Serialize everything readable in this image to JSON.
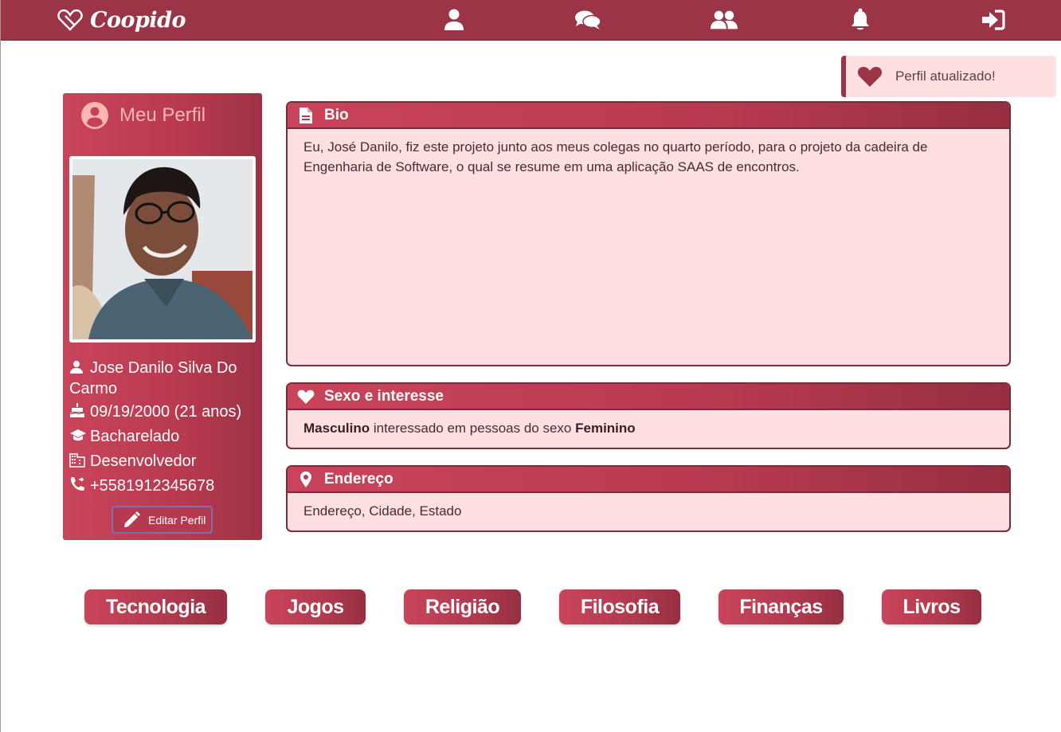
{
  "app": {
    "brand": "Coopido",
    "colors": {
      "primary": "#9b3446",
      "panel": "#fde0df",
      "accent": "#ffb6b1"
    }
  },
  "nav": {
    "items": [
      {
        "icon": "user-icon",
        "label": "Perfil"
      },
      {
        "icon": "chat-icon",
        "label": "Mensagens"
      },
      {
        "icon": "users-icon",
        "label": "Amigos"
      },
      {
        "icon": "bell-icon",
        "label": "Notificações"
      },
      {
        "icon": "sign-in-icon",
        "label": "Entrar"
      }
    ]
  },
  "toast": {
    "icon": "heart-icon",
    "message": "Perfil atualizado!"
  },
  "profile": {
    "title": "Meu Perfil",
    "name": "Jose Danilo Silva Do Carmo",
    "birthday": "09/19/2000 (21 anos)",
    "education": "Bacharelado",
    "job": "Desenvolvedor",
    "phone": "+5581912345678",
    "edit_label": "Editar Perfil"
  },
  "bio": {
    "title": "Bio",
    "text": "Eu, José Danilo, fiz este projeto junto aos meus colegas no quarto período, para o projeto da cadeira de Engenharia de Software, o qual se resume em uma aplicação SAAS de encontros."
  },
  "sexo": {
    "title": "Sexo e interesse",
    "gender": "Masculino",
    "middle": " interessado em pessoas do sexo ",
    "interest": "Feminino"
  },
  "endereco": {
    "title": "Endereço",
    "text": "Endereço, Cidade, Estado"
  },
  "interests": [
    "Tecnologia",
    "Jogos",
    "Religião",
    "Filosofia",
    "Finanças",
    "Livros"
  ]
}
